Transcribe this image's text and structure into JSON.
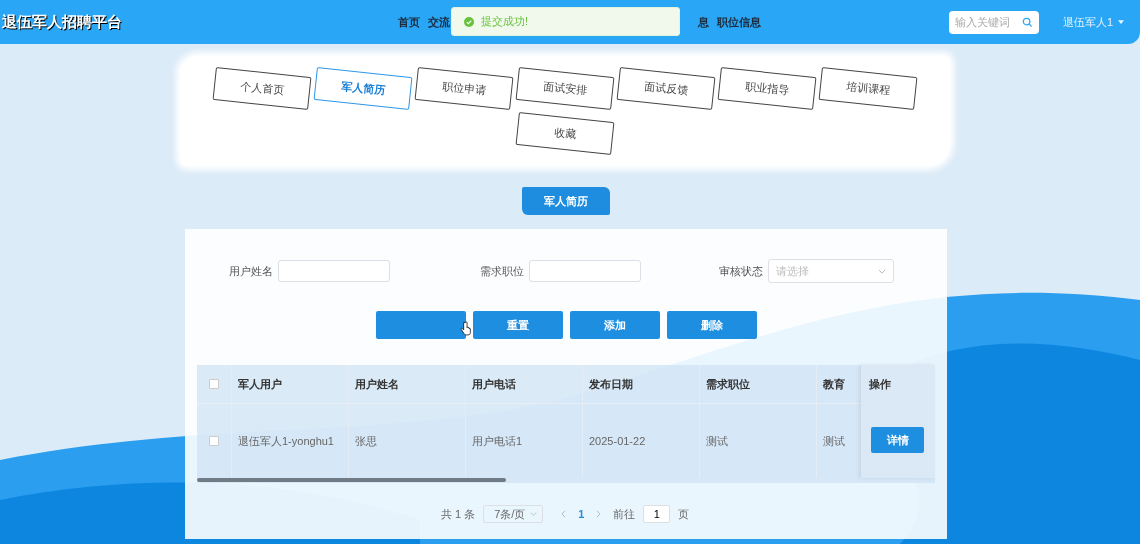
{
  "header": {
    "logo": "退伍军人招聘平台",
    "nav_left": [
      "首页",
      "交流"
    ],
    "nav_right": [
      "息",
      "职位信息"
    ],
    "search": {
      "placeholder": "输入关键词"
    },
    "user": "退伍军人1"
  },
  "toast": {
    "kind": "success",
    "text": "提交成功!"
  },
  "tabs": [
    {
      "label": "个人首页",
      "selected": false
    },
    {
      "label": "军人简历",
      "selected": true
    },
    {
      "label": "职位申请",
      "selected": false
    },
    {
      "label": "面试安排",
      "selected": false
    },
    {
      "label": "面试反馈",
      "selected": false
    },
    {
      "label": "职业指导",
      "selected": false
    },
    {
      "label": "培训课程",
      "selected": false
    },
    {
      "label": "收藏",
      "selected": false
    }
  ],
  "section_title": "军人简历",
  "filters": [
    {
      "kind": "input",
      "label": "用户姓名"
    },
    {
      "kind": "input",
      "label": "需求职位"
    },
    {
      "kind": "select",
      "label": "审核状态",
      "placeholder": "请选择"
    }
  ],
  "buttons": [
    "重置",
    "添加",
    "删除"
  ],
  "table": {
    "all_checked": false,
    "columns": [
      "军人用户",
      "用户姓名",
      "用户电话",
      "发布日期",
      "需求职位",
      "教育"
    ],
    "action_column": "操作",
    "rows": [
      {
        "checked": false,
        "cells": [
          "退伍军人1-yonghu1",
          "张思",
          "用户电话1",
          "2025-01-22",
          "测试",
          "测试"
        ],
        "action": "详情"
      }
    ]
  },
  "pagination": {
    "total": "共 1 条",
    "page_size": "7条/页",
    "pages": [
      {
        "label": "1",
        "selected": true
      }
    ],
    "goto_label": "前往",
    "goto_value": "1",
    "goto_suffix": "页"
  }
}
